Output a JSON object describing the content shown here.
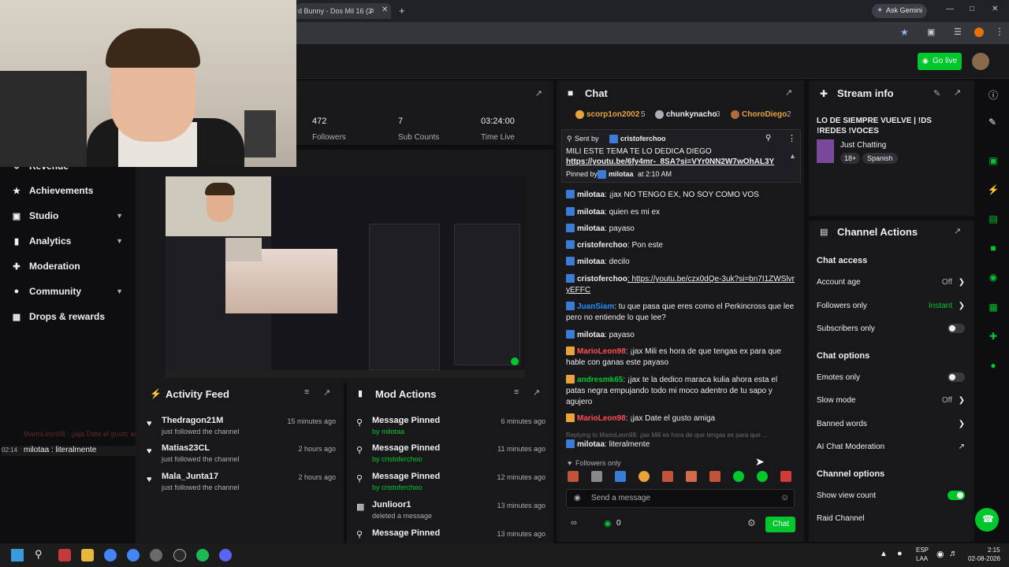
{
  "browser": {
    "tab_title": "d Bunny - Dos Mil 16 (3·",
    "ask_gemini": "Ask Gemini"
  },
  "header": {
    "go_live": "Go live"
  },
  "sidebar": {
    "items": [
      {
        "label": "Revenue",
        "icon": "dollar-icon"
      },
      {
        "label": "Achievements",
        "icon": "trophy-icon"
      },
      {
        "label": "Studio",
        "icon": "film-icon"
      },
      {
        "label": "Analytics",
        "icon": "chart-icon"
      },
      {
        "label": "Moderation",
        "icon": "wrench-icon"
      },
      {
        "label": "Community",
        "icon": "person-icon"
      },
      {
        "label": "Drops & rewards",
        "icon": "gift-icon"
      }
    ]
  },
  "overlay_chat": [
    {
      "time": "",
      "text": "MarioLeon98 : ¡jaja Date el gusto amiga"
    },
    {
      "time": "02:14",
      "text": "milotaa : literalmente"
    }
  ],
  "stats": [
    {
      "value": "472",
      "label": "Followers"
    },
    {
      "value": "7",
      "label": "Sub Counts"
    },
    {
      "value": "03:24:00",
      "label": "Time Live"
    }
  ],
  "activity_feed": {
    "title": "Activity Feed",
    "rows": [
      {
        "name": "Thedragon21M",
        "action": "just followed the channel",
        "time": "15 minutes ago"
      },
      {
        "name": "Matias23CL",
        "action": "just followed the channel",
        "time": "2 hours ago"
      },
      {
        "name": "Mala_Junta17",
        "action": "just followed the channel",
        "time": "2 hours ago"
      }
    ]
  },
  "mod_actions": {
    "title": "Mod Actions",
    "rows": [
      {
        "title": "Message Pinned",
        "by": "by milotaa",
        "time": "6 minutes ago"
      },
      {
        "title": "Message Pinned",
        "by": "by cristoferchoo",
        "time": "11 minutes ago"
      },
      {
        "title": "Message Pinned",
        "by": "by cristoferchoo",
        "time": "12 minutes ago"
      },
      {
        "title": "Junlioor1",
        "by": "deleted a message",
        "time": "13 minutes ago"
      },
      {
        "title": "Message Pinned",
        "by": "",
        "time": "13 minutes ago"
      }
    ]
  },
  "chat": {
    "title": "Chat",
    "top_chatters": [
      {
        "name": "scorp1on2002",
        "count": "5"
      },
      {
        "name": "chunkynacho",
        "count": "3"
      },
      {
        "name": "ChoroDiego",
        "count": "2"
      }
    ],
    "pinned": {
      "sent_by": "Sent by",
      "sender": "cristoferchoo",
      "text": "MILI ESTE TEMA TE LO DEDICA DIEGO",
      "link": "https://youtu.be/6fy4mr-_8SA?si=VYr0NN2W7wOhAL3Y",
      "pinned_by": "Pinned by",
      "pinner": "milotaa",
      "pinned_at": "at 2:10 AM"
    },
    "messages": [
      {
        "user": "milotaa",
        "color": "#efeff1",
        "text": ": ¡jax NO TENGO EX, NO SOY COMO VOS"
      },
      {
        "user": "milotaa",
        "color": "#efeff1",
        "text": ": quien es mi ex"
      },
      {
        "user": "milotaa",
        "color": "#efeff1",
        "text": ": payaso"
      },
      {
        "user": "cristoferchoo",
        "color": "#efeff1",
        "text": ": Pon este"
      },
      {
        "user": "milotaa",
        "color": "#efeff1",
        "text": ": decilo"
      },
      {
        "user": "cristoferchoo",
        "color": "#efeff1",
        "text": ": https://youtu.be/czx0dQe-3uk?si=bn7I1ZWSlvryEFFC"
      },
      {
        "user": "JuanSiam",
        "color": "#1e90ff",
        "text": ": tu que pasa que eres como el Perkincross que lee pero no entiende lo que lee?"
      },
      {
        "user": "milotaa",
        "color": "#efeff1",
        "text": ": payaso"
      },
      {
        "user": "MarioLeon98",
        "color": "#ff4f4f",
        "text": ": ¡jax Mili es hora de que tengas ex para que hable con ganas este payaso"
      },
      {
        "user": "andresmk65",
        "color": "#00c72c",
        "text": ": ¡jax te la dedico maraca kulia ahora esta el patas negra empujando todo mi moco adentro de tu sapo y agujero"
      },
      {
        "user": "MarioLeon98",
        "color": "#ff4f4f",
        "text": ": ¡jax Date el gusto amiga"
      }
    ],
    "reply_hint": "Replying to MarioLeon98: ¡jax Mili es hora de que tengas ex para que ...",
    "last": {
      "user": "milotaa",
      "text": ": literalmente"
    },
    "followers_only": "Followers only",
    "input_placeholder": "Send a message",
    "points": "0",
    "send_label": "Chat"
  },
  "stream_info": {
    "title": "Stream info",
    "stream_title": "LO DE SIEMPRE VUELVE | !DS !REDES !VOCES",
    "category": "Just Chatting",
    "tags": [
      "18+",
      "Spanish"
    ]
  },
  "channel_actions": {
    "title": "Channel Actions",
    "chat_access": "Chat access",
    "account_age": {
      "label": "Account age",
      "value": "Off"
    },
    "followers_only": {
      "label": "Followers only",
      "value": "Instant"
    },
    "subscribers_only": {
      "label": "Subscribers only"
    },
    "chat_options": "Chat options",
    "emotes_only": {
      "label": "Emotes only"
    },
    "slow_mode": {
      "label": "Slow mode",
      "value": "Off"
    },
    "banned_words": {
      "label": "Banned words"
    },
    "ai_moderation": {
      "label": "AI Chat Moderation"
    },
    "channel_options": "Channel options",
    "show_view_count": {
      "label": "Show view count"
    },
    "raid_channel": {
      "label": "Raid Channel"
    }
  },
  "taskbar": {
    "lang1": "ESP",
    "lang2": "LAA",
    "time": "2:15",
    "date": "02-08-2026"
  },
  "colors": {
    "accent": "#00c72c",
    "bg": "#0e0e10",
    "panel": "#18181b"
  }
}
